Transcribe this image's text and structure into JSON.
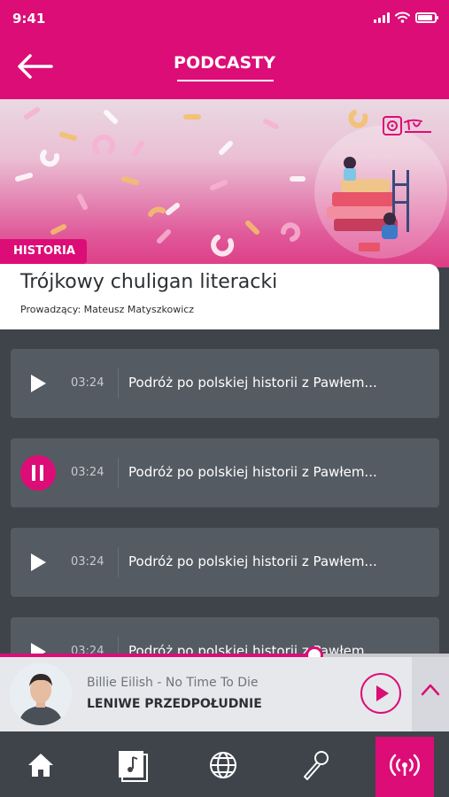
{
  "status_bar": {
    "time": "9:41"
  },
  "header": {
    "title": "PODCASTY"
  },
  "podcast": {
    "category": "HISTORIA",
    "title": "Trójkowy chuligan literacki",
    "host": "Prowadzący: Mateusz Matyszkowicz"
  },
  "episodes": [
    {
      "duration": "03:24",
      "title": "Podróż po polskiej historii z Pawłem...",
      "state": "play"
    },
    {
      "duration": "03:24",
      "title": "Podróż po polskiej historii z Pawłem...",
      "state": "pause"
    },
    {
      "duration": "03:24",
      "title": "Podróż po polskiej historii z Pawłem...",
      "state": "play"
    },
    {
      "duration": "03:24",
      "title": "Podróż po polskiej historii z Pawłem...",
      "state": "play"
    }
  ],
  "player": {
    "artist_track": "Billie Eilish  - No Time To Die",
    "show": "LENIWE PRZEDPOŁUDNIE",
    "progress": 0.7
  },
  "nav": [
    "home-icon",
    "music-library-icon",
    "globe-icon",
    "microphone-icon",
    "radio-broadcast-icon"
  ],
  "colors": {
    "accent": "#dc0d76",
    "background": "#3f444b",
    "card": "#555b63"
  }
}
